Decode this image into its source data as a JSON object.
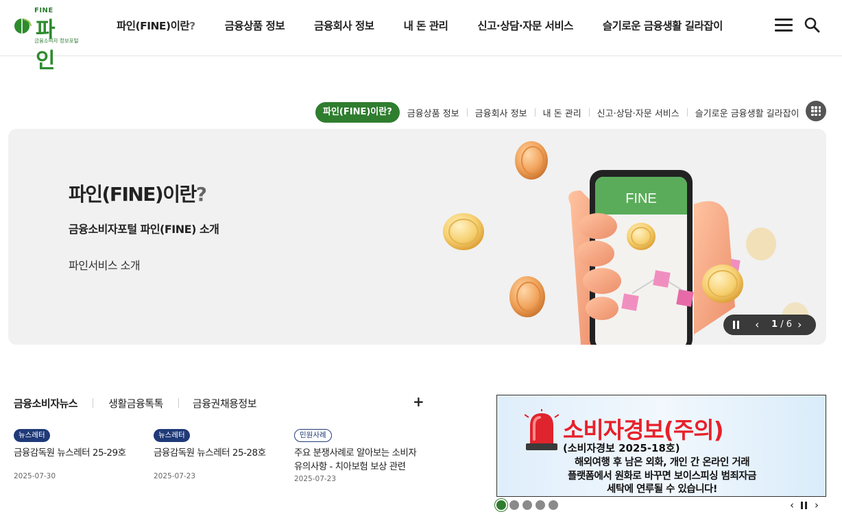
{
  "header": {
    "logo": {
      "top_text": "FINE",
      "name": "파인",
      "subtitle": "금융소비자 정보포털"
    },
    "nav": [
      {
        "label": "파인(FINE)이란",
        "suffix": "?"
      },
      {
        "label": "금융상품 정보",
        "suffix": ""
      },
      {
        "label": "금융회사 정보",
        "suffix": ""
      },
      {
        "label": "내 돈 관리",
        "suffix": ""
      },
      {
        "label": "신고·상담·자문 서비스",
        "suffix": ""
      },
      {
        "label": "슬기로운 금융생활 길라잡이",
        "suffix": ""
      }
    ],
    "icons": {
      "menu": "hamburger-menu-icon",
      "search": "search-icon"
    }
  },
  "category_tabs": {
    "active": "파인(FINE)이란?",
    "items": [
      "금융상품 정보",
      "금융회사 정보",
      "내 돈 관리",
      "신고·상담·자문 서비스",
      "슬기로운 금융생활 길라잡이"
    ],
    "grid_icon": "grid-menu-icon"
  },
  "hero": {
    "title": "파인(FINE)이란",
    "title_suffix": "?",
    "description_bold": "금융소비자포털 파인(FINE) 소개",
    "description": "파인서비스 소개",
    "phone_label": "FINE",
    "control": {
      "current": "1",
      "separator": "/",
      "total": "6"
    }
  },
  "news": {
    "tabs": [
      "금융소비자뉴스",
      "생활금융톡톡",
      "금융권채용정보"
    ],
    "more": "+",
    "items": [
      {
        "badge": "뉴스레터",
        "title": "금융감독원 뉴스레터 25-29호",
        "date": "2025-07-30"
      },
      {
        "badge": "뉴스레터",
        "title": "금융감독원 뉴스레터 25-28호",
        "date": "2025-07-23"
      },
      {
        "badge": "민원사례",
        "title": "주요 분쟁사례로 알아보는 소비자 유의사항 - 치아보험 보상 관련",
        "date": "2025-07-23"
      }
    ]
  },
  "alert_banner": {
    "heading": "소비자경보(주의)",
    "subheading": "(소비자경보 2025-18호)",
    "lines": [
      "해외여행 후 남은 외화, 개인 간 온라인 거래",
      "플랫폼에서 원화로 바꾸면 보이스피싱 범죄자금",
      "세탁에 연루될 수 있습니다!"
    ],
    "total_slides": 5,
    "current_slide": 1
  },
  "colors": {
    "brand_green": "#2f7d2f",
    "badge_navy": "#1f3a78",
    "alert_red": "#e8202a"
  }
}
